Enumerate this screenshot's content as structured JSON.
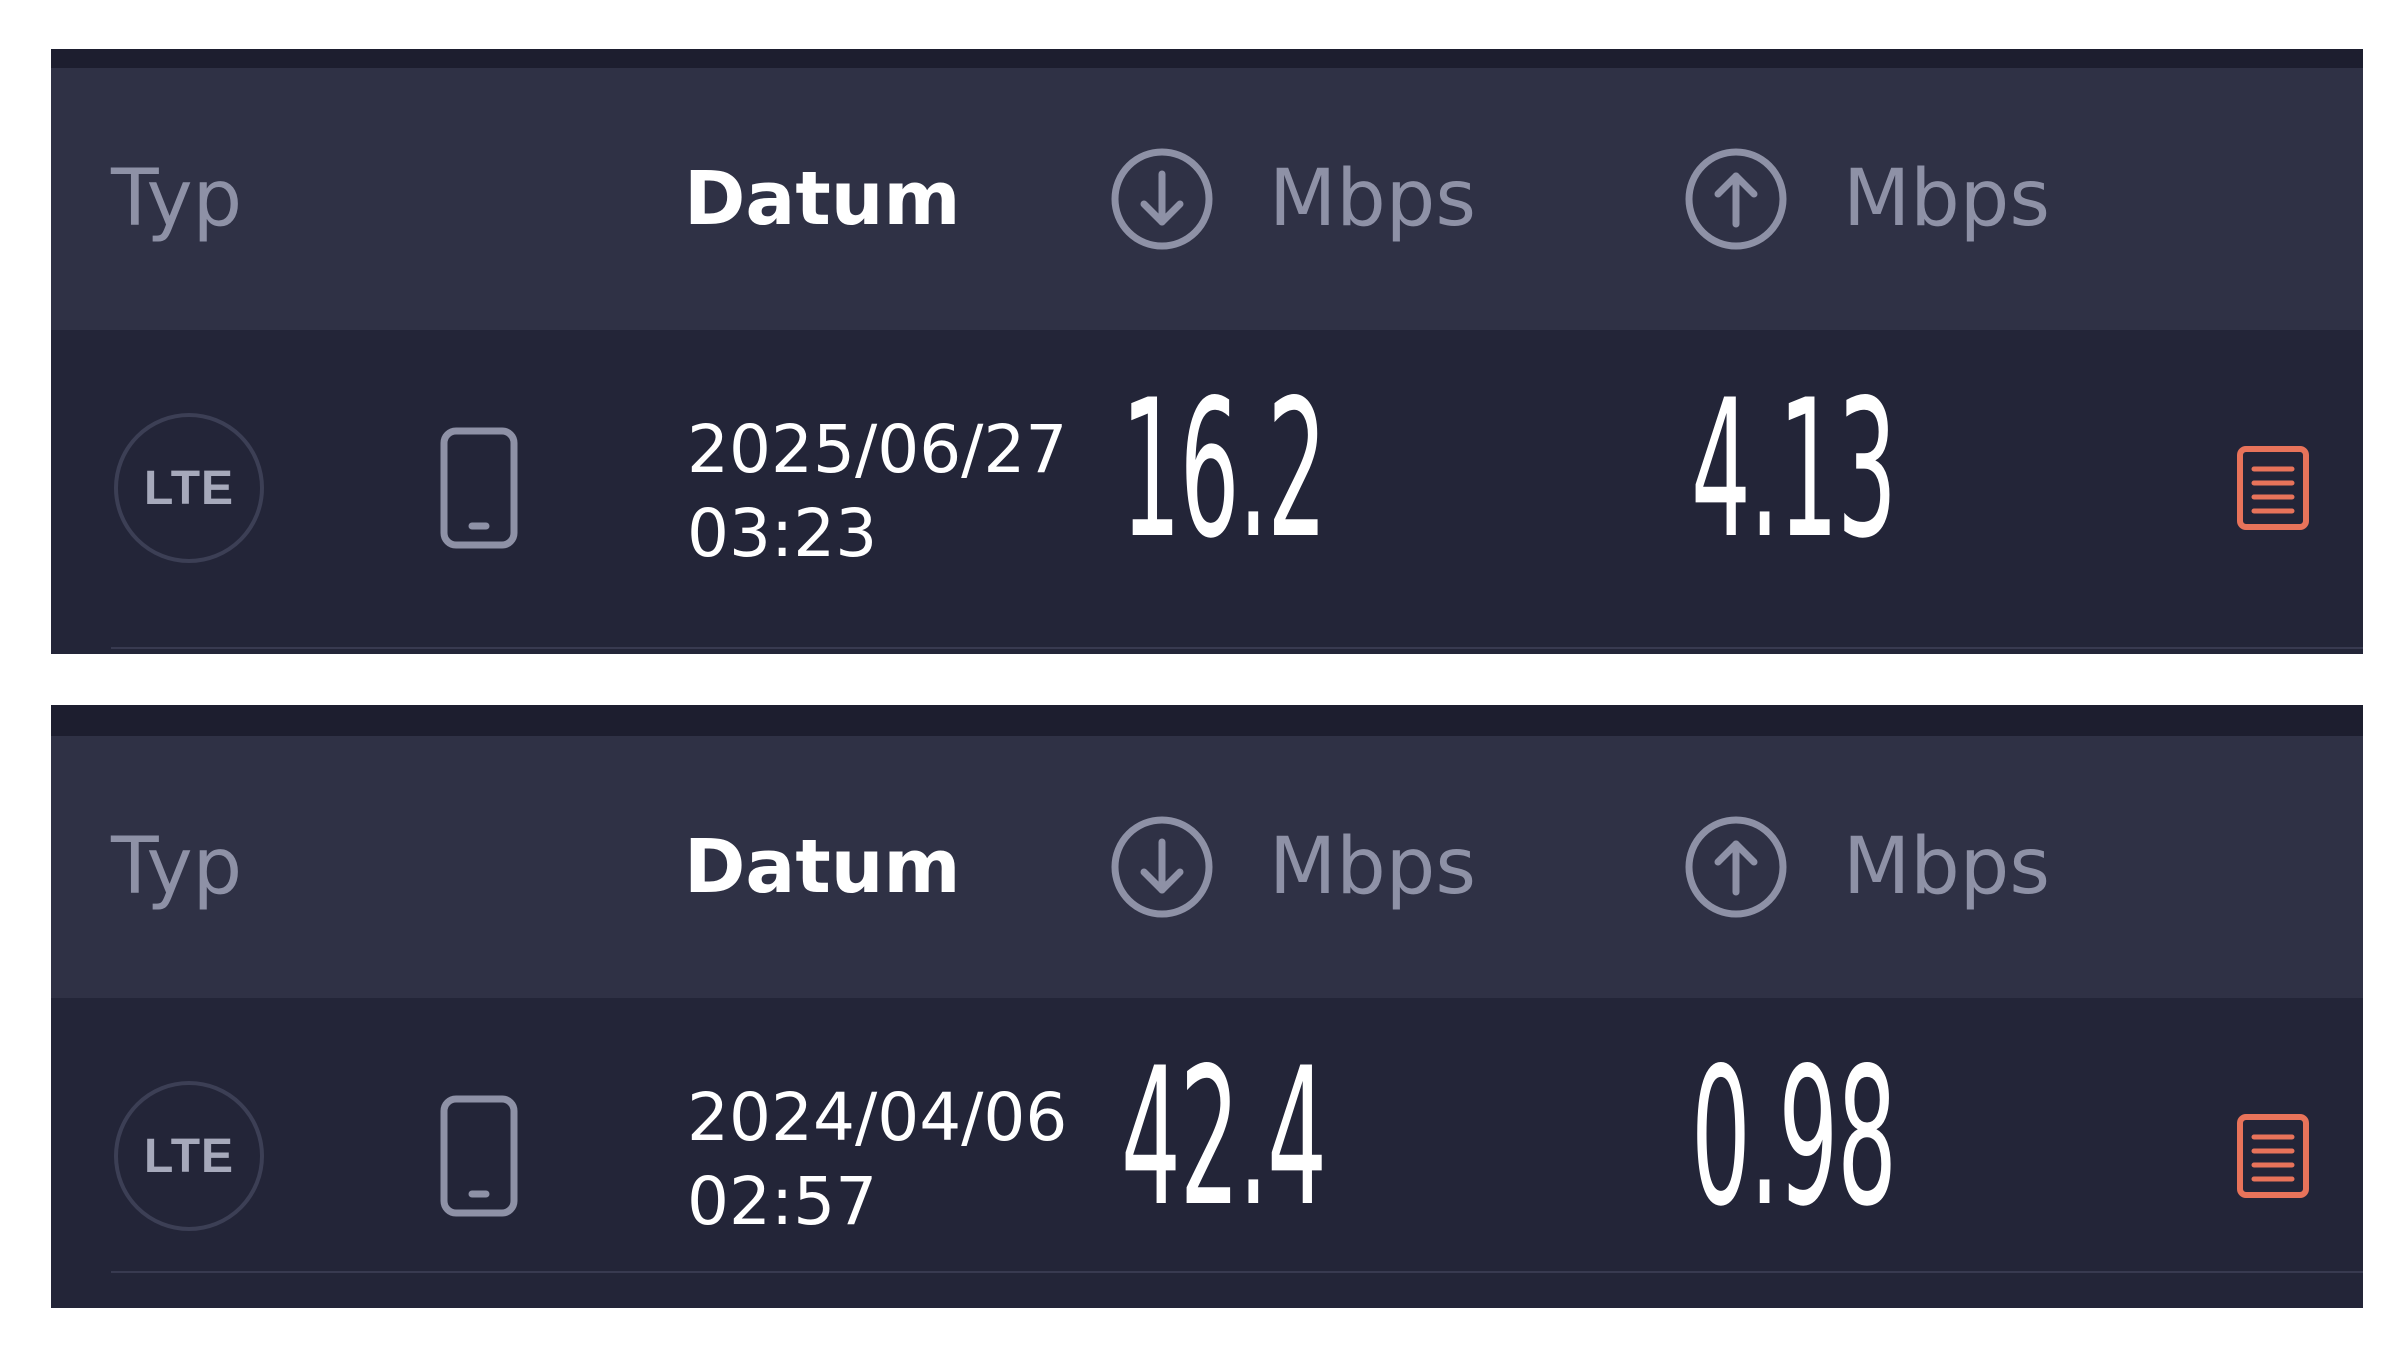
{
  "panels": [
    {
      "header": {
        "type_label": "Typ",
        "date_label": "Datum",
        "download_icon": "arrow-down-circle-icon",
        "download_unit": "Mbps",
        "upload_icon": "arrow-up-circle-icon",
        "upload_unit": "Mbps"
      },
      "result": {
        "connection_type": "LTE",
        "device_icon": "smartphone-icon",
        "date": "2025/06/27",
        "time": "03:23",
        "download": "16.2",
        "upload": "4.13",
        "report_icon": "report-document-icon"
      }
    },
    {
      "header": {
        "type_label": "Typ",
        "date_label": "Datum",
        "download_icon": "arrow-down-circle-icon",
        "download_unit": "Mbps",
        "upload_icon": "arrow-up-circle-icon",
        "upload_unit": "Mbps"
      },
      "result": {
        "connection_type": "LTE",
        "device_icon": "smartphone-icon",
        "date": "2024/04/06",
        "time": "02:57",
        "download": "42.4",
        "upload": "0.98",
        "report_icon": "report-document-icon"
      }
    }
  ],
  "colors": {
    "background": "#232538",
    "header_background": "#2f3145",
    "top_bar": "#1d1e2f",
    "muted_text": "#8e91a6",
    "primary_text": "#ffffff",
    "accent_report": "#e8735a"
  }
}
